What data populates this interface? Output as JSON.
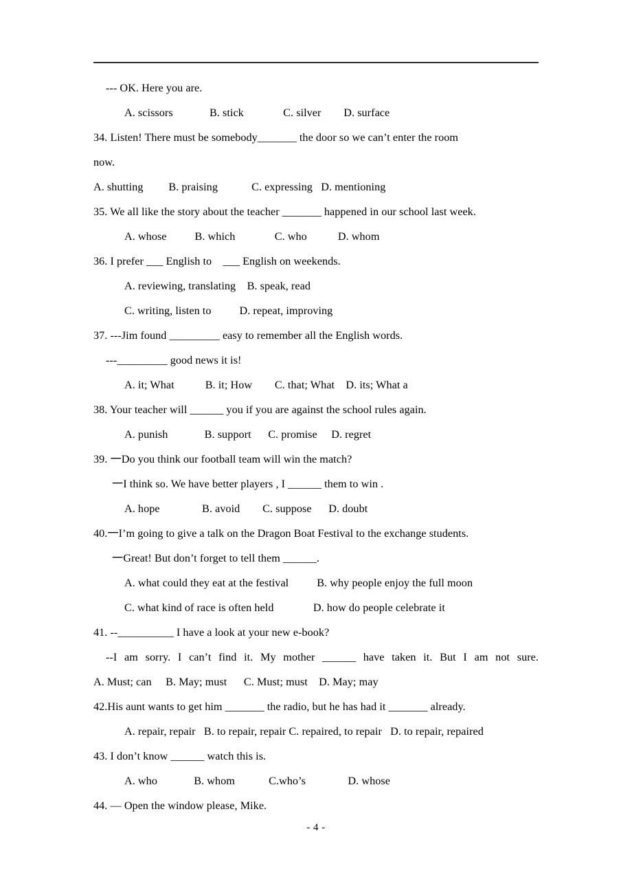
{
  "document": {
    "page_number": "- 4 -",
    "subject_hint": "English multiple-choice grammar exercise",
    "lines": [
      {
        "indent": 2,
        "text": "--- OK. Here you are."
      },
      {
        "indent": 4,
        "text": "A. scissors             B. stick              C. silver        D. surface"
      },
      {
        "indent": 0,
        "text": "34. Listen! There must be somebody_______ the door so we can’t enter the room"
      },
      {
        "indent": 0,
        "text": "now."
      },
      {
        "indent": 0,
        "text": "A. shutting         B. praising            C. expressing   D. mentioning"
      },
      {
        "indent": 0,
        "text": "35. We all like the story about the teacher _______ happened in our school last week."
      },
      {
        "indent": 4,
        "text": "A. whose          B. which              C. who           D. whom"
      },
      {
        "indent": 0,
        "text": "36. I prefer ___ English to    ___ English on weekends."
      },
      {
        "indent": 4,
        "text": "A. reviewing, translating    B. speak, read"
      },
      {
        "indent": 4,
        "text": "C. writing, listen to          D. repeat, improving"
      },
      {
        "indent": 0,
        "text": "37. ---Jim found _________ easy to remember all the English words."
      },
      {
        "indent": 2,
        "text": "---_________ good news it is!"
      },
      {
        "indent": 4,
        "text": "A. it; What           B. it; How        C. that; What    D. its; What a"
      },
      {
        "indent": 0,
        "text": "38. Your teacher will ______ you if you are against the school rules again."
      },
      {
        "indent": 4,
        "text": "A. punish             B. support      C. promise     D. regret"
      },
      {
        "indent": 0,
        "text": "39. 一Do you think our football team will win the match?"
      },
      {
        "indent": 3,
        "text": "一I think so. We have better players , I ______ them to win ."
      },
      {
        "indent": 4,
        "text": "A. hope               B. avoid        C. suppose      D. doubt"
      },
      {
        "indent": 0,
        "text": "40.一I’m going to give a talk on the Dragon Boat Festival to the exchange students."
      },
      {
        "indent": 3,
        "text": "一Great! But don’t forget to tell them ______."
      },
      {
        "indent": 4,
        "text": "A. what could they eat at the festival          B. why people enjoy the full moon"
      },
      {
        "indent": 4,
        "text": "C. what kind of race is often held              D. how do people celebrate it"
      },
      {
        "indent": 0,
        "text": "41. --__________ I have a look at your new e-book?"
      },
      {
        "indent": 2,
        "justify": true,
        "text": "--I am sorry. I can’t find it. My mother ______ have taken it. But I am not sure."
      },
      {
        "indent": 0,
        "text": "A. Must; can     B. May; must      C. Must; must    D. May; may"
      },
      {
        "indent": 0,
        "text": "42.His aunt wants to get him _______ the radio, but he has had it _______ already."
      },
      {
        "indent": 4,
        "text": "A. repair, repair   B. to repair, repair C. repaired, to repair   D. to repair, repaired"
      },
      {
        "indent": 0,
        "text": "43. I don’t know ______ watch this is."
      },
      {
        "indent": 4,
        "text": "A. who             B. whom            C.who’s               D. whose"
      },
      {
        "indent": 0,
        "text": "44. — Open the window please, Mike."
      }
    ]
  }
}
